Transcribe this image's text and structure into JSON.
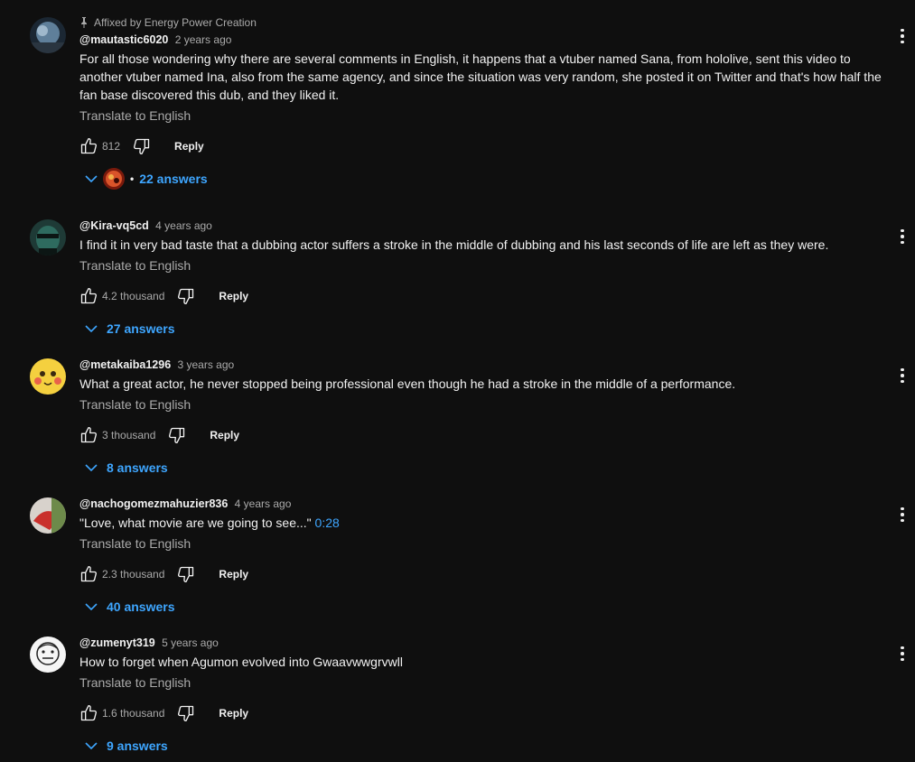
{
  "pinned_label": "Affixed by Energy Power Creation",
  "translate_label": "Translate to English",
  "reply_label": "Reply",
  "colors": {
    "background": "#0f0f0f",
    "link": "#3ea6ff",
    "secondary_text": "#aaaaaa"
  },
  "comments": [
    {
      "handle": "@mautastic6020",
      "time": "2 years ago",
      "text": "For all those wondering why there are several comments in English, it happens that a vtuber named Sana, from hololive, sent this video to another vtuber named Ina, also from the same agency, and since the situation was very random, she posted it on Twitter and that's how half the fan base discovered this dub, and they liked it.",
      "likes": "812",
      "answers": "22 answers"
    },
    {
      "handle": "@Kira-vq5cd",
      "time": "4 years ago",
      "text": "I find it in very bad taste that a dubbing actor suffers a stroke in the middle of dubbing and his last seconds of life are left as they were.",
      "likes": "4.2 thousand",
      "answers": "27 answers"
    },
    {
      "handle": "@metakaiba1296",
      "time": "3 years ago",
      "text": "What a great actor, he never stopped being professional even though he had a stroke in the middle of a performance.",
      "likes": "3 thousand",
      "answers": "8 answers"
    },
    {
      "handle": "@nachogomezmahuzier836",
      "time": "4 years ago",
      "text": "\"Love, what movie are we going to see...\"",
      "timestamp": "0:28",
      "likes": "2.3 thousand",
      "answers": "40 answers"
    },
    {
      "handle": "@zumenyt319",
      "time": "5 years ago",
      "text": "How to forget when Agumon evolved into Gwaavwwgrvwll",
      "likes": "1.6 thousand",
      "answers": "9 answers"
    }
  ]
}
